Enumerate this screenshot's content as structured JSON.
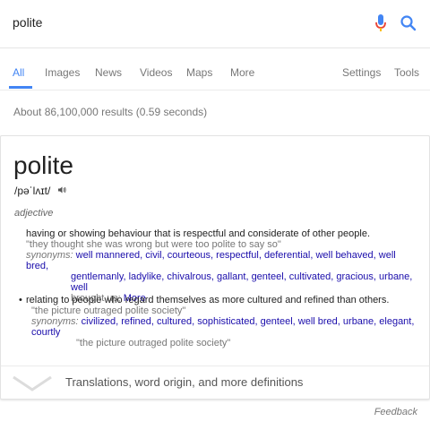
{
  "search": {
    "query": "polite"
  },
  "tabs": [
    {
      "label": "All"
    },
    {
      "label": "Images"
    },
    {
      "label": "News"
    },
    {
      "label": "Videos"
    },
    {
      "label": "Maps"
    },
    {
      "label": "More"
    },
    {
      "label": "Settings"
    },
    {
      "label": "Tools"
    }
  ],
  "result_stats": "About 86,100,000 results (0.59 seconds)",
  "dictionary": {
    "word": "polite",
    "pronunciation": "/pəˈlʌɪt/",
    "part_of_speech": "adjective",
    "sense1": {
      "definition": "having or showing behaviour that is respectful and considerate of other people.",
      "example": "\"they thought she was wrong but were too polite to say so\"",
      "synonyms_label": "synonyms:",
      "syn_line1": "well mannered, civil, courteous, respectful, deferential, well behaved, well bred,",
      "syn_line2": "gentlemanly, ladylike, chivalrous, gallant, genteel, cultivated, gracious, urbane, well",
      "syn_line3": "brought up;",
      "more_link": "More"
    },
    "sense2": {
      "definition": "relating to people who regard themselves as more cultured and refined than others.",
      "example": "\"the picture outraged polite society\"",
      "synonyms_label": "synonyms:",
      "syn_line1": "civilized, refined, cultured, sophisticated, genteel, well bred, urbane, elegant, courtly",
      "syn_example": "\"the picture outraged polite society\""
    },
    "more_definitions": "Translations, word origin, and more definitions"
  },
  "feedback": "Feedback",
  "colors": {
    "accent": "#4285f4",
    "link": "#1a0dab",
    "mic_red": "#ea4335"
  },
  "icons": [
    "microphone-icon",
    "search-icon",
    "speaker-icon",
    "chevron-down-icon"
  ]
}
